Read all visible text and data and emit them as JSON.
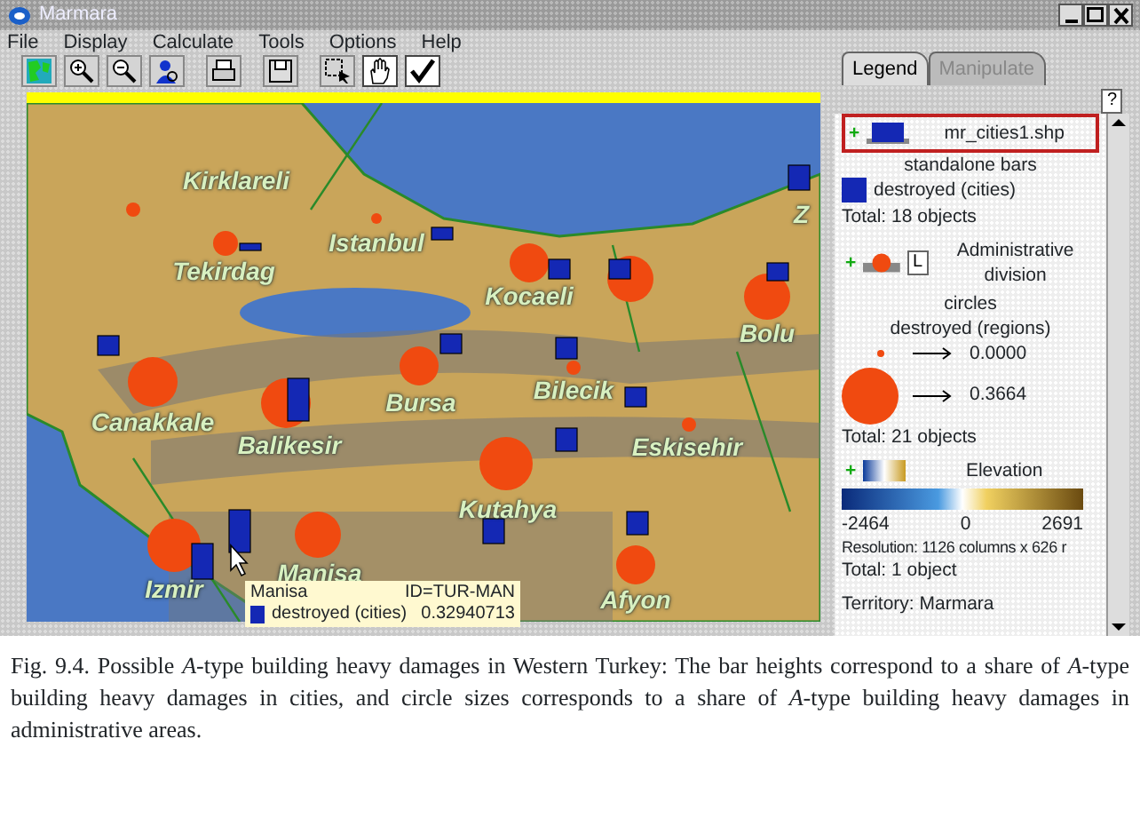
{
  "window": {
    "title": "Marmara"
  },
  "menu": [
    "File",
    "Display",
    "Calculate",
    "Tools",
    "Options",
    "Help"
  ],
  "toolbar": [
    {
      "kind": "map",
      "selected": false
    },
    {
      "kind": "zoom-in",
      "selected": false
    },
    {
      "kind": "zoom-out",
      "selected": false
    },
    {
      "kind": "person",
      "selected": false
    },
    {
      "kind": "print",
      "selected": false
    },
    {
      "kind": "save",
      "selected": false
    },
    {
      "kind": "select",
      "selected": false
    },
    {
      "kind": "hand",
      "selected": true
    },
    {
      "kind": "check",
      "selected": true
    }
  ],
  "map": {
    "labels": [
      "Kirklareli",
      "Istanbul",
      "Tekirdag",
      "Kocaeli",
      "Bolu",
      "Canakkale",
      "Balikesir",
      "Bursa",
      "Bilecik",
      "Eskisehir",
      "Kutahya",
      "Izmir",
      "Manisa",
      "Afyon",
      "Z"
    ],
    "tooltip": {
      "name": "Manisa",
      "id": "ID=TUR-MAN",
      "attribute": "destroyed (cities)",
      "value": "0.32940713"
    }
  },
  "legend_tabs": [
    {
      "label": "Legend",
      "selected": true
    },
    {
      "label": "Manipulate",
      "selected": false
    }
  ],
  "help_button": "?",
  "layers": [
    {
      "kind": "bars",
      "expand": "+",
      "name": "mr_cities1.shp",
      "selected": true,
      "lines": [
        "standalone bars"
      ],
      "item": "destroyed (cities)",
      "total": "Total: 18 objects"
    },
    {
      "kind": "circles",
      "expand": "+",
      "button": "L",
      "name": "Administrative division",
      "selected": false,
      "lines": [
        "circles",
        "destroyed (regions)"
      ],
      "min": "0.0000",
      "max": "0.3664",
      "total": "Total: 21 objects"
    },
    {
      "kind": "raster",
      "expand": "+",
      "name": "Elevation",
      "selected": false,
      "scale": [
        "-2464",
        "0",
        "2691"
      ],
      "lines": [
        "Resolution: 1126 columns x 626 r"
      ],
      "total": "Total: 1 object"
    }
  ],
  "territory": "Territory: Marmara",
  "caption": "Fig. 9.4. Possible *A*-type building heavy damages in Western Turkey: The bar heights correspond to a share of *A*-type building heavy damages in cities, and circle sizes corresponds to a share of *A*-type building heavy damages in administrative areas."
}
